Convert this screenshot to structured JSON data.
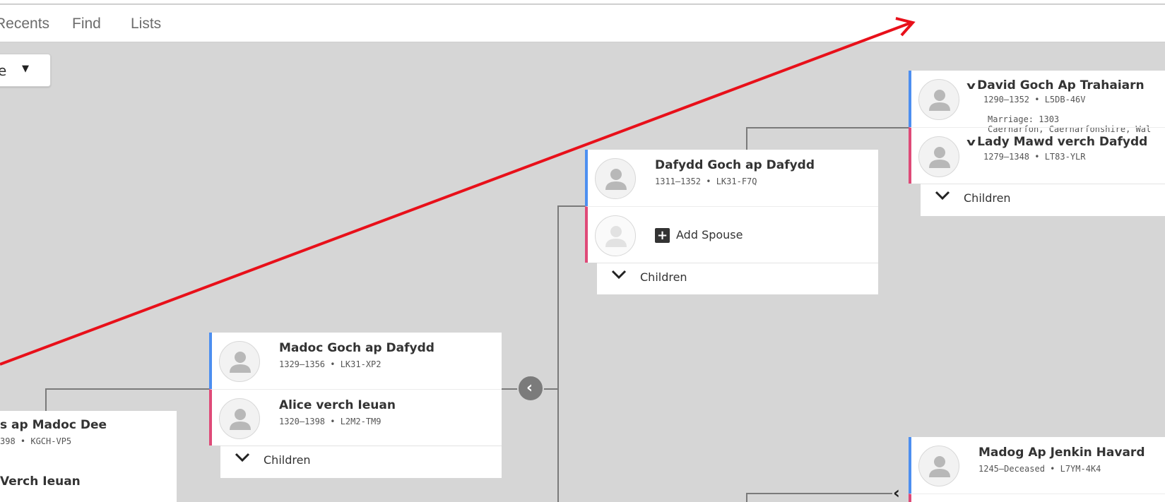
{
  "nav": {
    "items": [
      {
        "label": "Recents"
      },
      {
        "label": "Find"
      },
      {
        "label": "Lists"
      }
    ]
  },
  "view_selector": {
    "value": "e",
    "caret": "▼"
  },
  "persons": {
    "dafydd_goch": {
      "name": "Dafydd Goch ap Dafydd",
      "meta": "1311–1352 • LK31-F7Q"
    },
    "madoc_goch": {
      "name": "Madoc Goch ap Dafydd",
      "meta": "1329–1356 • LK31-XP2"
    },
    "alice": {
      "name": "Alice verch Ieuan",
      "meta": "1320–1398 • L2M2-TM9"
    },
    "david_goch": {
      "name": "David Goch Ap Trahaiarn",
      "meta": "1290–1352 • L5DB-46V"
    },
    "lady_mawd": {
      "name": "Lady Mawd verch Dafydd",
      "meta": "1279–1348 • LT83-YLR"
    },
    "madog_ap_jenkin": {
      "name": "Madog Ap Jenkin Havard",
      "meta": "1245–Deceased • L7YM-4K4"
    },
    "left_father": {
      "name": "s ap Madoc Dee",
      "meta": "398 • KGCH-VP5"
    },
    "left_mother": {
      "name": "Verch Ieuan"
    }
  },
  "marriage": {
    "line1": "Marriage: 1303",
    "line2": "Caernarfon, Caernarfonshire, Wal"
  },
  "add_spouse_label": "Add Spouse",
  "children_label": "Children",
  "colors": {
    "male": "#4d8ff0",
    "female": "#df4a78",
    "arrow": "#e8101a",
    "background": "#d6d6d6"
  }
}
